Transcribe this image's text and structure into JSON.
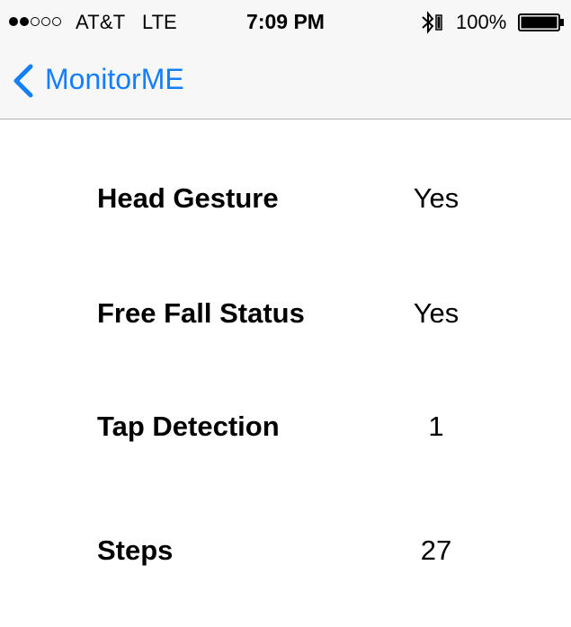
{
  "status_bar": {
    "signal_bars_filled": 2,
    "signal_bars_total": 5,
    "carrier": "AT&T",
    "network": "LTE",
    "time": "7:09 PM",
    "bluetooth_icon": "bluetooth-icon",
    "battery_percent": "100%",
    "battery_level": 1.0
  },
  "nav": {
    "back_icon": "chevron-left-icon",
    "back_label": "MonitorME",
    "accent_color": "#157efb"
  },
  "rows": [
    {
      "label": "Head Gesture",
      "value": "Yes"
    },
    {
      "label": "Free Fall Status",
      "value": "Yes"
    },
    {
      "label": "Tap Detection",
      "value": "1"
    },
    {
      "label": "Steps",
      "value": "27"
    }
  ]
}
